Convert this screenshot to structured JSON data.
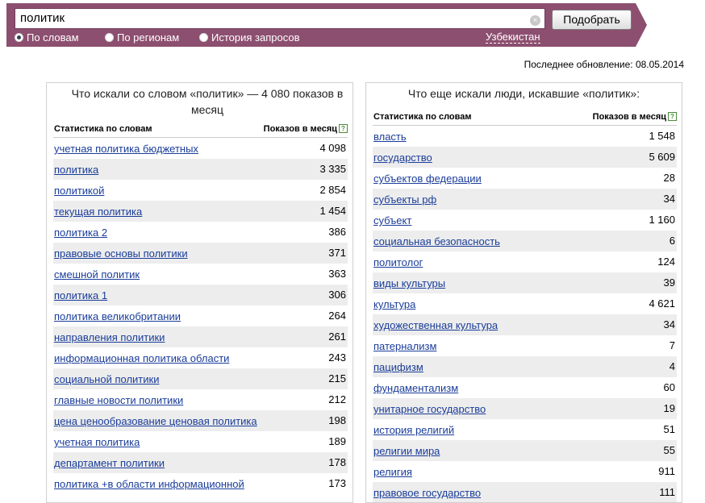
{
  "search": {
    "query": "политик",
    "clear_icon": "×",
    "submit_label": "Подобрать",
    "modes": [
      {
        "label": "По словам",
        "checked": true
      },
      {
        "label": "По регионам",
        "checked": false
      },
      {
        "label": "История запросов",
        "checked": false
      }
    ],
    "region": "Узбекистан"
  },
  "updated": "Последнее обновление: 08.05.2014",
  "left": {
    "title": "Что искали со словом «политик» — 4 080 показов в месяц",
    "col_phrase": "Статистика по словам",
    "col_count": "Показов в месяц",
    "help": "?",
    "rows": [
      {
        "phrase": "учетная политика бюджетных",
        "count": "4 098"
      },
      {
        "phrase": "политика",
        "count": "3 335"
      },
      {
        "phrase": "политикой",
        "count": "2 854"
      },
      {
        "phrase": "текущая политика",
        "count": "1 454"
      },
      {
        "phrase": "политика 2",
        "count": "386"
      },
      {
        "phrase": "правовые основы политики",
        "count": "371"
      },
      {
        "phrase": "смешной политик",
        "count": "363"
      },
      {
        "phrase": "политика 1",
        "count": "306"
      },
      {
        "phrase": "политика великобритании",
        "count": "264"
      },
      {
        "phrase": "направления политики",
        "count": "261"
      },
      {
        "phrase": "информационная политика области",
        "count": "243"
      },
      {
        "phrase": "социальной политики",
        "count": "215"
      },
      {
        "phrase": "главные новости политики",
        "count": "212"
      },
      {
        "phrase": "цена ценообразование ценовая политика",
        "count": "198"
      },
      {
        "phrase": "учетная политика",
        "count": "189"
      },
      {
        "phrase": "департамент политики",
        "count": "178"
      },
      {
        "phrase": "политика +в области информационной",
        "count": "173"
      }
    ]
  },
  "right": {
    "title": "Что еще искали люди, искавшие «политик»:",
    "col_phrase": "Статистика по словам",
    "col_count": "Показов в месяц",
    "help": "?",
    "rows": [
      {
        "phrase": "власть",
        "count": "1 548"
      },
      {
        "phrase": "государство",
        "count": "5 609"
      },
      {
        "phrase": "субъектов федерации",
        "count": "28"
      },
      {
        "phrase": "субъекты рф",
        "count": "34"
      },
      {
        "phrase": "субъект",
        "count": "1 160"
      },
      {
        "phrase": "социальная безопасность",
        "count": "6"
      },
      {
        "phrase": "политолог",
        "count": "124"
      },
      {
        "phrase": "виды культуры",
        "count": "39"
      },
      {
        "phrase": "культура",
        "count": "4 621"
      },
      {
        "phrase": "художественная культура",
        "count": "34"
      },
      {
        "phrase": "патернализм",
        "count": "7"
      },
      {
        "phrase": "пацифизм",
        "count": "4"
      },
      {
        "phrase": "фундаментализм",
        "count": "60"
      },
      {
        "phrase": "унитарное государство",
        "count": "19"
      },
      {
        "phrase": "история религий",
        "count": "51"
      },
      {
        "phrase": "религии мира",
        "count": "55"
      },
      {
        "phrase": "религия",
        "count": "911"
      },
      {
        "phrase": "правовое государство",
        "count": "111"
      }
    ]
  }
}
